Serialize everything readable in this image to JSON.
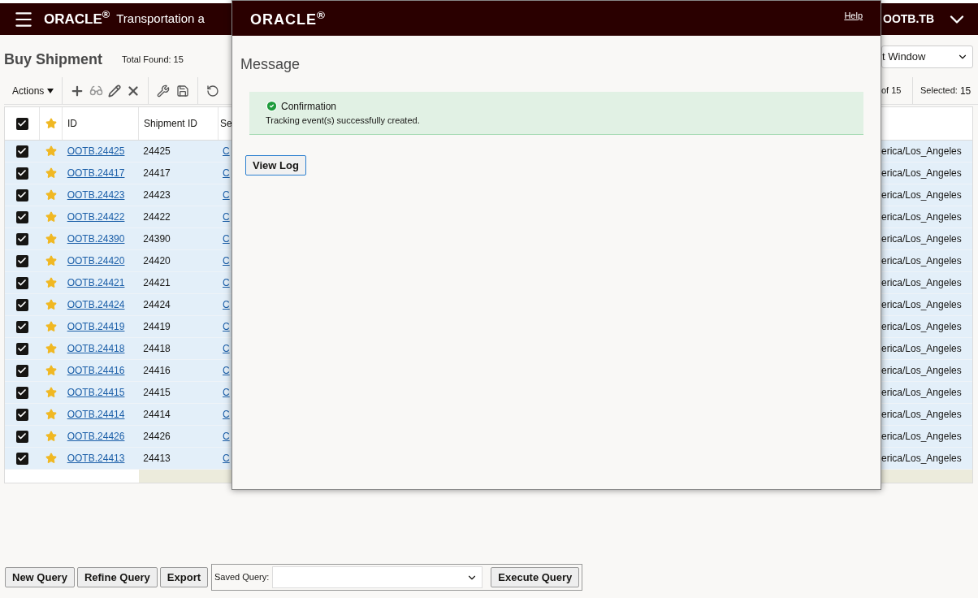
{
  "app_header": {
    "brand": "ORACLE$^{®}$",
    "product_title": "Transportation a",
    "user": "OOTB.TB"
  },
  "page": {
    "title": "Buy Shipment",
    "total_found": "Total Found: 15"
  },
  "toolbar": {
    "actions": "Actions"
  },
  "window_select": {
    "value": "t Window"
  },
  "pager": {
    "count": "of 15",
    "selected_label": "Selected:",
    "selected_count": "15"
  },
  "table": {
    "select_all_checked": true,
    "columns": [
      "ID",
      "Shipment ID",
      "Se"
    ],
    "rows": [
      {
        "checked": true,
        "id": "OOTB.24425",
        "shipment_id": "24425",
        "column_3": "C",
        "last_column": "erica/Los_Angeles"
      },
      {
        "checked": true,
        "id": "OOTB.24417",
        "shipment_id": "24417",
        "column_3": "C",
        "last_column": "erica/Los_Angeles"
      },
      {
        "checked": true,
        "id": "OOTB.24423",
        "shipment_id": "24423",
        "column_3": "C",
        "last_column": "erica/Los_Angeles"
      },
      {
        "checked": true,
        "id": "OOTB.24422",
        "shipment_id": "24422",
        "column_3": "C",
        "last_column": "erica/Los_Angeles"
      },
      {
        "checked": true,
        "id": "OOTB.24390",
        "shipment_id": "24390",
        "column_3": "C",
        "last_column": "erica/Los_Angeles"
      },
      {
        "checked": true,
        "id": "OOTB.24420",
        "shipment_id": "24420",
        "column_3": "C",
        "last_column": "erica/Los_Angeles"
      },
      {
        "checked": true,
        "id": "OOTB.24421",
        "shipment_id": "24421",
        "column_3": "C",
        "last_column": "erica/Los_Angeles"
      },
      {
        "checked": true,
        "id": "OOTB.24424",
        "shipment_id": "24424",
        "column_3": "C",
        "last_column": "erica/Los_Angeles"
      },
      {
        "checked": true,
        "id": "OOTB.24419",
        "shipment_id": "24419",
        "column_3": "C",
        "last_column": "erica/Los_Angeles"
      },
      {
        "checked": true,
        "id": "OOTB.24418",
        "shipment_id": "24418",
        "column_3": "C",
        "last_column": "erica/Los_Angeles"
      },
      {
        "checked": true,
        "id": "OOTB.24416",
        "shipment_id": "24416",
        "column_3": "C",
        "last_column": "erica/Los_Angeles"
      },
      {
        "checked": true,
        "id": "OOTB.24415",
        "shipment_id": "24415",
        "column_3": "C",
        "last_column": "erica/Los_Angeles"
      },
      {
        "checked": true,
        "id": "OOTB.24414",
        "shipment_id": "24414",
        "column_3": "C",
        "last_column": "erica/Los_Angeles"
      },
      {
        "checked": true,
        "id": "OOTB.24426",
        "shipment_id": "24426",
        "column_3": "C",
        "last_column": "erica/Los_Angeles"
      },
      {
        "checked": true,
        "id": "OOTB.24413",
        "shipment_id": "24413",
        "column_3": "C",
        "last_column": "erica/Los_Angeles"
      }
    ]
  },
  "dialog": {
    "brand": "ORACLE$^{®}$",
    "help": "Help",
    "title": "Message",
    "message": {
      "heading": "Confirmation",
      "text": "Tracking event(s) successfully created."
    },
    "buttons": [
      "View Log"
    ]
  },
  "bottom_bar": {
    "buttons": [
      "New Query",
      "Refine Query",
      "Export"
    ],
    "saved_query_label": "Saved Query:",
    "execute": "Execute Query"
  }
}
